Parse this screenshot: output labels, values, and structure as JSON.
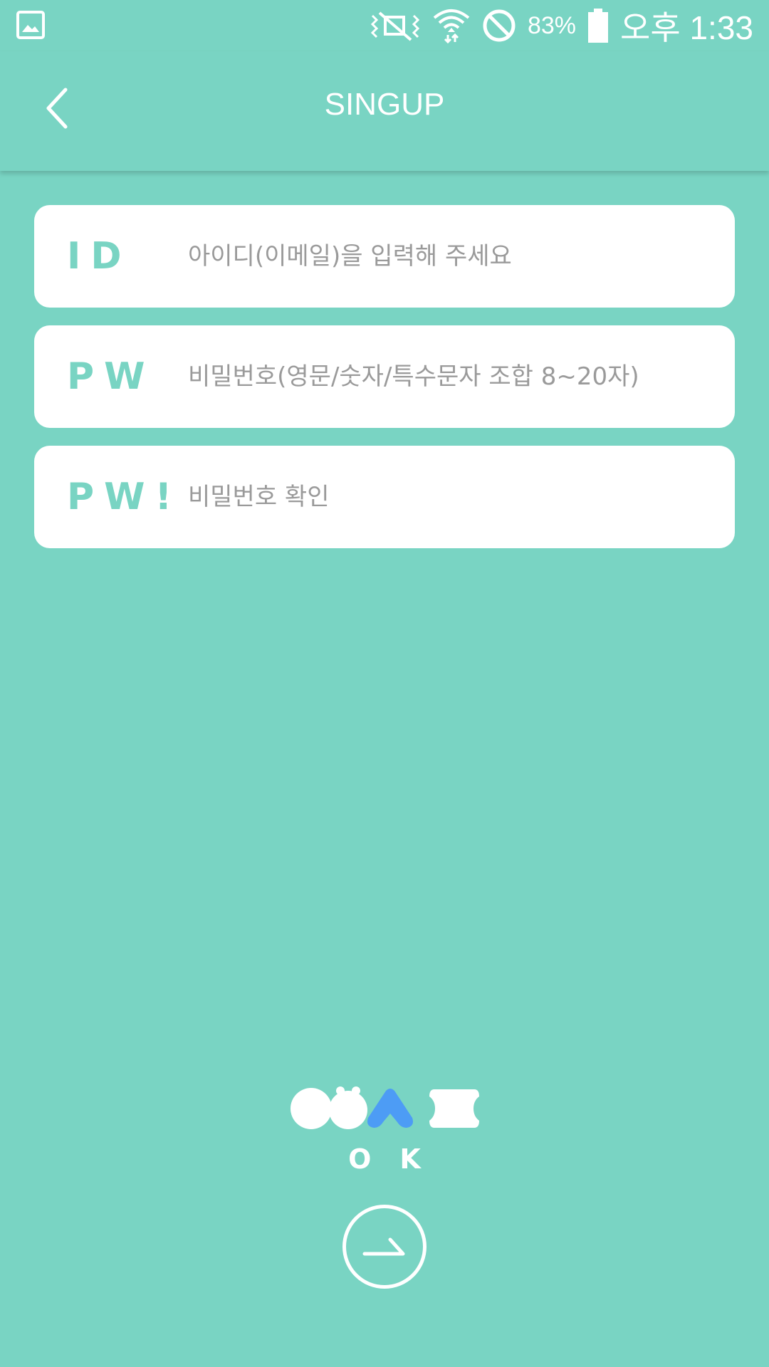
{
  "status_bar": {
    "battery": "83%",
    "time": "오후 1:33",
    "icons": [
      "image-icon",
      "vibrate-off-icon",
      "wifi-icon",
      "do-not-disturb-icon",
      "battery-icon"
    ]
  },
  "header": {
    "title": "SINGUP",
    "back_icon": "chevron-left-icon"
  },
  "form": {
    "id": {
      "tag": "ID",
      "placeholder": "아이디(이메일)을 입력해 주세요",
      "value": ""
    },
    "pw": {
      "tag": "PW",
      "placeholder": "비밀번호(영문/숫자/특수문자 조합 8~20자)",
      "value": ""
    },
    "pw_confirm": {
      "tag": "PW!",
      "placeholder": "비밀번호 확인",
      "value": ""
    }
  },
  "submit": {
    "label": "OK",
    "logo_icon": "brand-logo-icon",
    "next_icon": "arrow-right-icon"
  },
  "colors": {
    "background": "#79d4c3",
    "accent": "#79d4c3",
    "logo_blue": "#4d9cf5",
    "card": "#ffffff",
    "placeholder": "#9a9a9a"
  }
}
